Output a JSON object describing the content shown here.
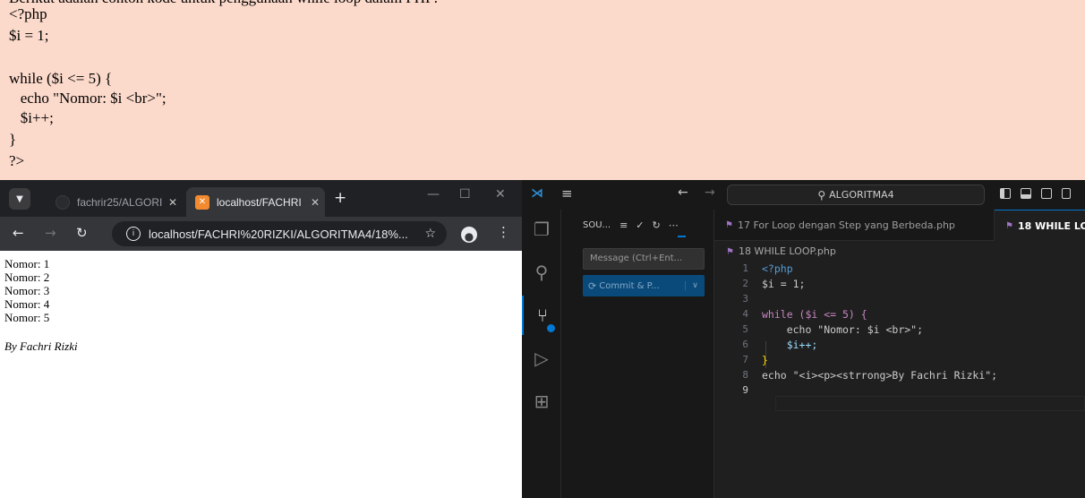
{
  "document": {
    "clipped_line": "Berikut adalah contoh kode untuk penggunaan while loop dalam PHP:",
    "code_lines": [
      "<?php",
      "$i = 1;",
      "",
      "while ($i <= 5) {",
      "   echo \"Nomor: $i <br>\";",
      "   $i++;",
      "}",
      "?>"
    ]
  },
  "browser": {
    "tabs": [
      {
        "title": "fachrir25/ALGORI",
        "active": false
      },
      {
        "title": "localhost/FACHRI",
        "active": true
      }
    ],
    "url": "localhost/FACHRI%20RIZKI/ALGORITMA4/18%...",
    "output_lines": [
      "Nomor: 1",
      "Nomor: 2",
      "Nomor: 3",
      "Nomor: 4",
      "Nomor: 5"
    ],
    "byline": "By Fachri Rizki"
  },
  "vscode": {
    "search": "ALGORITMA4",
    "sidebar": {
      "title": "SOU...",
      "message_placeholder": "Message (Ctrl+Ent...",
      "commit_label": "Commit & P..."
    },
    "tabs": [
      {
        "title": "17 For Loop dengan Step yang Berbeda.php",
        "active": false
      },
      {
        "title": "18 WHILE LO",
        "active": true
      }
    ],
    "breadcrumb": "18 WHILE LOOP.php",
    "line_numbers": [
      "1",
      "2",
      "3",
      "4",
      "5",
      "6",
      "7",
      "8",
      "9"
    ],
    "code_lines": [
      "<?php",
      "$i = 1;",
      "",
      "while ($i <= 5) {",
      "    echo \"Nomor: $i <br>\";",
      "    $i++;",
      "}",
      "echo \"<i><p><strrong>By Fachri Rizki\";",
      ""
    ]
  }
}
